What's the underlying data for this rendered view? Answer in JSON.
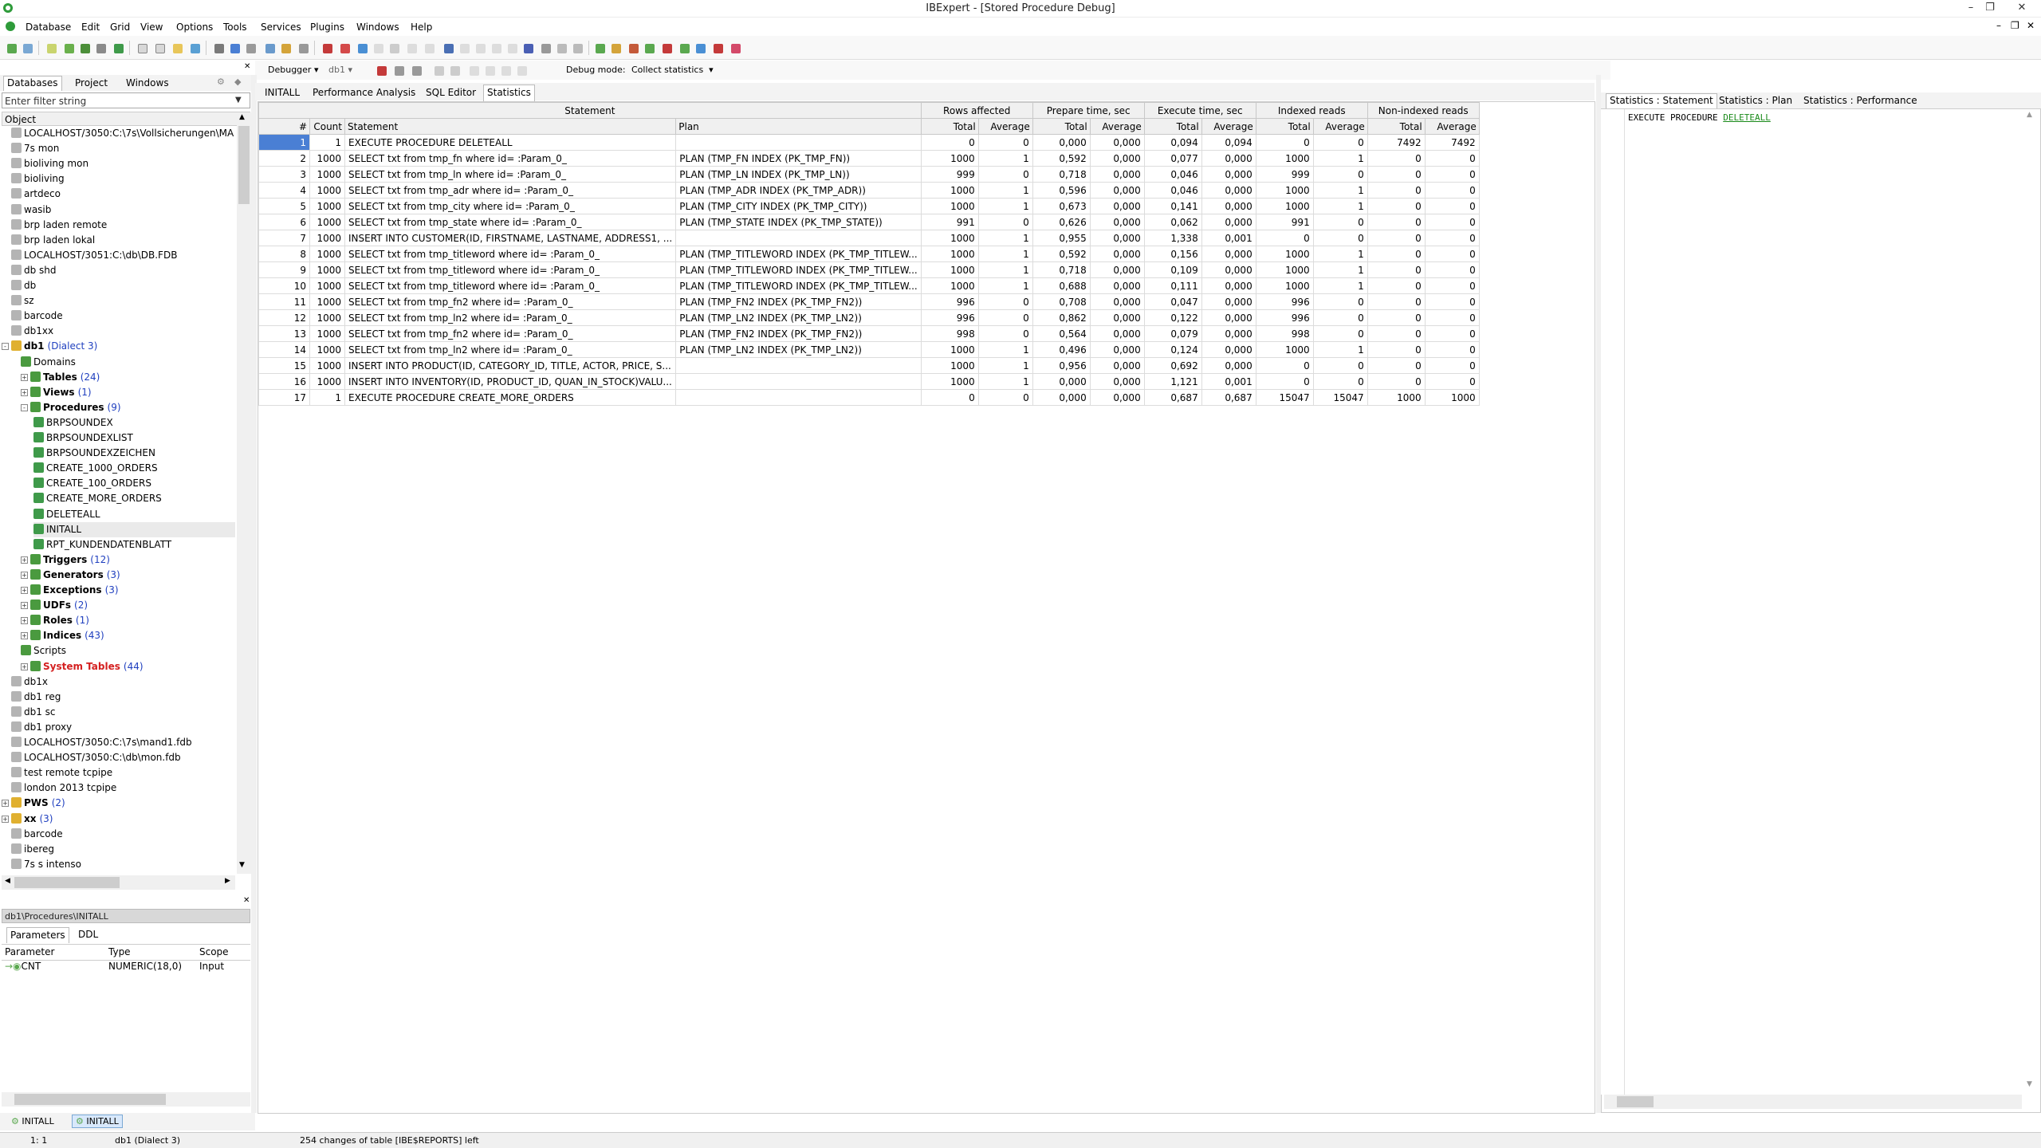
{
  "window": {
    "title": "IBExpert - [Stored Procedure Debug]"
  },
  "menu": [
    "Database",
    "Edit",
    "Grid",
    "View",
    "Options",
    "Tools",
    "Services",
    "Plugins",
    "Windows",
    "Help"
  ],
  "toolbar2": {
    "debugger_label": "Debugger",
    "db_label": "db1",
    "debug_mode_label": "Debug mode:",
    "debug_mode_value": "Collect statistics"
  },
  "left_tabs": [
    "Databases",
    "Project",
    "Windows"
  ],
  "filter_placeholder": "Enter filter string",
  "object_header": "Object",
  "tree": [
    {
      "label": "LOCALHOST/3050:C:\\7s\\Vollsicherungen\\MA",
      "level": 1
    },
    {
      "label": "7s mon",
      "level": 1
    },
    {
      "label": "bioliving mon",
      "level": 1
    },
    {
      "label": "bioliving",
      "level": 1
    },
    {
      "label": "artdeco",
      "level": 1
    },
    {
      "label": "wasib",
      "level": 1
    },
    {
      "label": "brp laden remote",
      "level": 1
    },
    {
      "label": "brp laden lokal",
      "level": 1
    },
    {
      "label": "LOCALHOST/3051:C:\\db\\DB.FDB",
      "level": 1
    },
    {
      "label": "db shd",
      "level": 1
    },
    {
      "label": "db",
      "level": 1
    },
    {
      "label": "sz",
      "level": 1
    },
    {
      "label": "barcode",
      "level": 1
    },
    {
      "label": "db1xx",
      "level": 1
    },
    {
      "label": "db1",
      "count": "(Dialect 3)",
      "level": 0,
      "bold": true,
      "exp": "-"
    },
    {
      "label": "Domains",
      "level": 2
    },
    {
      "label": "Tables",
      "count": "(24)",
      "level": 2,
      "bold": true,
      "exp": "+"
    },
    {
      "label": "Views",
      "count": "(1)",
      "level": 2,
      "bold": true,
      "exp": "+"
    },
    {
      "label": "Procedures",
      "count": "(9)",
      "level": 2,
      "bold": true,
      "exp": "-"
    },
    {
      "label": "BRPSOUNDEX",
      "level": 3
    },
    {
      "label": "BRPSOUNDEXLIST",
      "level": 3
    },
    {
      "label": "BRPSOUNDEXZEICHEN",
      "level": 3
    },
    {
      "label": "CREATE_1000_ORDERS",
      "level": 3
    },
    {
      "label": "CREATE_100_ORDERS",
      "level": 3
    },
    {
      "label": "CREATE_MORE_ORDERS",
      "level": 3
    },
    {
      "label": "DELETEALL",
      "level": 3
    },
    {
      "label": "INITALL",
      "level": 3
    },
    {
      "label": "RPT_KUNDENDATENBLATT",
      "level": 3
    },
    {
      "label": "Triggers",
      "count": "(12)",
      "level": 2,
      "bold": true,
      "exp": "+"
    },
    {
      "label": "Generators",
      "count": "(3)",
      "level": 2,
      "bold": true,
      "exp": "+"
    },
    {
      "label": "Exceptions",
      "count": "(3)",
      "level": 2,
      "bold": true,
      "exp": "+"
    },
    {
      "label": "UDFs",
      "count": "(2)",
      "level": 2,
      "bold": true,
      "exp": "+"
    },
    {
      "label": "Roles",
      "count": "(1)",
      "level": 2,
      "bold": true,
      "exp": "+"
    },
    {
      "label": "Indices",
      "count": "(43)",
      "level": 2,
      "bold": true,
      "exp": "+"
    },
    {
      "label": "Scripts",
      "level": 2
    },
    {
      "label": "System Tables",
      "count": "(44)",
      "level": 2,
      "red": true,
      "exp": "+"
    },
    {
      "label": "db1x",
      "level": 1
    },
    {
      "label": "db1 reg",
      "level": 1
    },
    {
      "label": "db1 sc",
      "level": 1
    },
    {
      "label": "db1 proxy",
      "level": 1
    },
    {
      "label": "LOCALHOST/3050:C:\\7s\\mand1.fdb",
      "level": 1
    },
    {
      "label": "LOCALHOST/3050:C:\\db\\mon.fdb",
      "level": 1
    },
    {
      "label": "test remote tcpipe",
      "level": 1
    },
    {
      "label": "london 2013 tcpipe",
      "level": 1
    },
    {
      "label": "PWS",
      "count": "(2)",
      "level": 0,
      "bold": true,
      "exp": "+"
    },
    {
      "label": "xx",
      "count": "(3)",
      "level": 0,
      "bold": true,
      "exp": "+"
    },
    {
      "label": "barcode",
      "level": 1
    },
    {
      "label": "ibereg",
      "level": 1
    },
    {
      "label": "7s s intenso",
      "level": 1
    }
  ],
  "path_bar": "db1\\Procedures\\INITALL",
  "param_tabs": [
    "Parameters",
    "DDL"
  ],
  "param_headers": [
    "Parameter",
    "Type",
    "Scope"
  ],
  "param_row": {
    "name": "CNT",
    "type": "NUMERIC(18,0)",
    "scope": "Input"
  },
  "bottom_tabs": [
    "INITALL",
    "INITALL"
  ],
  "status": {
    "pos": "1: 1",
    "db": "db1 (Dialect 3)",
    "msg": "254 changes of table [IBE$REPORTS] left"
  },
  "main_tabs": [
    "INITALL",
    "Performance Analysis",
    "SQL Editor",
    "Statistics"
  ],
  "grid": {
    "group_headers": [
      "Statement",
      "Rows affected",
      "Prepare time, sec",
      "Execute time, sec",
      "Indexed reads",
      "Non-indexed reads"
    ],
    "col_headers": [
      "#",
      "Count",
      "Statement",
      "Plan",
      "Total",
      "Average",
      "Total",
      "Average",
      "Total",
      "Average",
      "Total",
      "Average",
      "Total",
      "Average"
    ],
    "rows": [
      [
        "1",
        "1",
        "EXECUTE PROCEDURE DELETEALL",
        "",
        "0",
        "0",
        "0,000",
        "0,000",
        "0,094",
        "0,094",
        "0",
        "0",
        "7492",
        "7492"
      ],
      [
        "2",
        "1000",
        "SELECT txt from tmp_fn where id= :Param_0_",
        "PLAN (TMP_FN INDEX (PK_TMP_FN))",
        "1000",
        "1",
        "0,592",
        "0,000",
        "0,077",
        "0,000",
        "1000",
        "1",
        "0",
        "0"
      ],
      [
        "3",
        "1000",
        "SELECT txt from tmp_ln where id= :Param_0_",
        "PLAN (TMP_LN INDEX (PK_TMP_LN))",
        "999",
        "0",
        "0,718",
        "0,000",
        "0,046",
        "0,000",
        "999",
        "0",
        "0",
        "0"
      ],
      [
        "4",
        "1000",
        "SELECT txt from tmp_adr where id= :Param_0_",
        "PLAN (TMP_ADR INDEX (PK_TMP_ADR))",
        "1000",
        "1",
        "0,596",
        "0,000",
        "0,046",
        "0,000",
        "1000",
        "1",
        "0",
        "0"
      ],
      [
        "5",
        "1000",
        "SELECT txt from tmp_city where id= :Param_0_",
        "PLAN (TMP_CITY INDEX (PK_TMP_CITY))",
        "1000",
        "1",
        "0,673",
        "0,000",
        "0,141",
        "0,000",
        "1000",
        "1",
        "0",
        "0"
      ],
      [
        "6",
        "1000",
        "SELECT txt from tmp_state where id= :Param_0_",
        "PLAN (TMP_STATE INDEX (PK_TMP_STATE))",
        "991",
        "0",
        "0,626",
        "0,000",
        "0,062",
        "0,000",
        "991",
        "0",
        "0",
        "0"
      ],
      [
        "7",
        "1000",
        "INSERT INTO CUSTOMER(ID, FIRSTNAME, LASTNAME, ADDRESS1, ...",
        "",
        "1000",
        "1",
        "0,955",
        "0,000",
        "1,338",
        "0,001",
        "0",
        "0",
        "0",
        "0"
      ],
      [
        "8",
        "1000",
        "SELECT txt from tmp_titleword where id= :Param_0_",
        "PLAN (TMP_TITLEWORD INDEX (PK_TMP_TITLEW...",
        "1000",
        "1",
        "0,592",
        "0,000",
        "0,156",
        "0,000",
        "1000",
        "1",
        "0",
        "0"
      ],
      [
        "9",
        "1000",
        "SELECT txt from tmp_titleword where id= :Param_0_",
        "PLAN (TMP_TITLEWORD INDEX (PK_TMP_TITLEW...",
        "1000",
        "1",
        "0,718",
        "0,000",
        "0,109",
        "0,000",
        "1000",
        "1",
        "0",
        "0"
      ],
      [
        "10",
        "1000",
        "SELECT txt from tmp_titleword where id= :Param_0_",
        "PLAN (TMP_TITLEWORD INDEX (PK_TMP_TITLEW...",
        "1000",
        "1",
        "0,688",
        "0,000",
        "0,111",
        "0,000",
        "1000",
        "1",
        "0",
        "0"
      ],
      [
        "11",
        "1000",
        "SELECT txt from tmp_fn2 where id= :Param_0_",
        "PLAN (TMP_FN2 INDEX (PK_TMP_FN2))",
        "996",
        "0",
        "0,708",
        "0,000",
        "0,047",
        "0,000",
        "996",
        "0",
        "0",
        "0"
      ],
      [
        "12",
        "1000",
        "SELECT txt from tmp_ln2 where id= :Param_0_",
        "PLAN (TMP_LN2 INDEX (PK_TMP_LN2))",
        "996",
        "0",
        "0,862",
        "0,000",
        "0,122",
        "0,000",
        "996",
        "0",
        "0",
        "0"
      ],
      [
        "13",
        "1000",
        "SELECT txt from tmp_fn2 where id= :Param_0_",
        "PLAN (TMP_FN2 INDEX (PK_TMP_FN2))",
        "998",
        "0",
        "0,564",
        "0,000",
        "0,079",
        "0,000",
        "998",
        "0",
        "0",
        "0"
      ],
      [
        "14",
        "1000",
        "SELECT txt from tmp_ln2 where id= :Param_0_",
        "PLAN (TMP_LN2 INDEX (PK_TMP_LN2))",
        "1000",
        "1",
        "0,496",
        "0,000",
        "0,124",
        "0,000",
        "1000",
        "1",
        "0",
        "0"
      ],
      [
        "15",
        "1000",
        "INSERT INTO PRODUCT(ID, CATEGORY_ID, TITLE, ACTOR, PRICE, S...",
        "",
        "1000",
        "1",
        "0,956",
        "0,000",
        "0,692",
        "0,000",
        "0",
        "0",
        "0",
        "0"
      ],
      [
        "16",
        "1000",
        "INSERT INTO INVENTORY(ID, PRODUCT_ID, QUAN_IN_STOCK)VALU...",
        "",
        "1000",
        "1",
        "0,000",
        "0,000",
        "1,121",
        "0,001",
        "0",
        "0",
        "0",
        "0"
      ],
      [
        "17",
        "1",
        "EXECUTE PROCEDURE CREATE_MORE_ORDERS",
        "",
        "0",
        "0",
        "0,000",
        "0,000",
        "0,687",
        "0,687",
        "15047",
        "15047",
        "1000",
        "1000"
      ]
    ]
  },
  "right_tabs": [
    "Statistics : Statement",
    "Statistics : Plan",
    "Statistics : Performance"
  ],
  "code": {
    "keyword": "EXECUTE PROCEDURE",
    "link": "DELETEALL"
  },
  "colors": {
    "selection": "#4a7fd4",
    "link": "#1a8a1a",
    "count": "#1f3fbf",
    "system": "#d42020"
  }
}
